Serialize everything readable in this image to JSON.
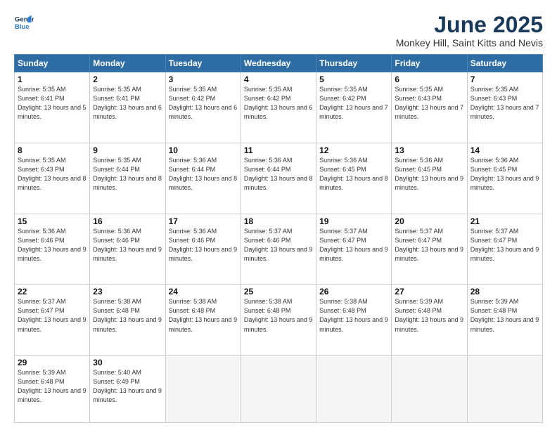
{
  "header": {
    "logo_line1": "General",
    "logo_line2": "Blue",
    "title": "June 2025",
    "location": "Monkey Hill, Saint Kitts and Nevis"
  },
  "weekdays": [
    "Sunday",
    "Monday",
    "Tuesday",
    "Wednesday",
    "Thursday",
    "Friday",
    "Saturday"
  ],
  "weeks": [
    [
      {
        "day": 1,
        "sunrise": "5:35 AM",
        "sunset": "6:41 PM",
        "daylight": "13 hours and 5 minutes."
      },
      {
        "day": 2,
        "sunrise": "5:35 AM",
        "sunset": "6:41 PM",
        "daylight": "13 hours and 6 minutes."
      },
      {
        "day": 3,
        "sunrise": "5:35 AM",
        "sunset": "6:42 PM",
        "daylight": "13 hours and 6 minutes."
      },
      {
        "day": 4,
        "sunrise": "5:35 AM",
        "sunset": "6:42 PM",
        "daylight": "13 hours and 6 minutes."
      },
      {
        "day": 5,
        "sunrise": "5:35 AM",
        "sunset": "6:42 PM",
        "daylight": "13 hours and 7 minutes."
      },
      {
        "day": 6,
        "sunrise": "5:35 AM",
        "sunset": "6:43 PM",
        "daylight": "13 hours and 7 minutes."
      },
      {
        "day": 7,
        "sunrise": "5:35 AM",
        "sunset": "6:43 PM",
        "daylight": "13 hours and 7 minutes."
      }
    ],
    [
      {
        "day": 8,
        "sunrise": "5:35 AM",
        "sunset": "6:43 PM",
        "daylight": "13 hours and 8 minutes."
      },
      {
        "day": 9,
        "sunrise": "5:35 AM",
        "sunset": "6:44 PM",
        "daylight": "13 hours and 8 minutes."
      },
      {
        "day": 10,
        "sunrise": "5:36 AM",
        "sunset": "6:44 PM",
        "daylight": "13 hours and 8 minutes."
      },
      {
        "day": 11,
        "sunrise": "5:36 AM",
        "sunset": "6:44 PM",
        "daylight": "13 hours and 8 minutes."
      },
      {
        "day": 12,
        "sunrise": "5:36 AM",
        "sunset": "6:45 PM",
        "daylight": "13 hours and 8 minutes."
      },
      {
        "day": 13,
        "sunrise": "5:36 AM",
        "sunset": "6:45 PM",
        "daylight": "13 hours and 9 minutes."
      },
      {
        "day": 14,
        "sunrise": "5:36 AM",
        "sunset": "6:45 PM",
        "daylight": "13 hours and 9 minutes."
      }
    ],
    [
      {
        "day": 15,
        "sunrise": "5:36 AM",
        "sunset": "6:46 PM",
        "daylight": "13 hours and 9 minutes."
      },
      {
        "day": 16,
        "sunrise": "5:36 AM",
        "sunset": "6:46 PM",
        "daylight": "13 hours and 9 minutes."
      },
      {
        "day": 17,
        "sunrise": "5:36 AM",
        "sunset": "6:46 PM",
        "daylight": "13 hours and 9 minutes."
      },
      {
        "day": 18,
        "sunrise": "5:37 AM",
        "sunset": "6:46 PM",
        "daylight": "13 hours and 9 minutes."
      },
      {
        "day": 19,
        "sunrise": "5:37 AM",
        "sunset": "6:47 PM",
        "daylight": "13 hours and 9 minutes."
      },
      {
        "day": 20,
        "sunrise": "5:37 AM",
        "sunset": "6:47 PM",
        "daylight": "13 hours and 9 minutes."
      },
      {
        "day": 21,
        "sunrise": "5:37 AM",
        "sunset": "6:47 PM",
        "daylight": "13 hours and 9 minutes."
      }
    ],
    [
      {
        "day": 22,
        "sunrise": "5:37 AM",
        "sunset": "6:47 PM",
        "daylight": "13 hours and 9 minutes."
      },
      {
        "day": 23,
        "sunrise": "5:38 AM",
        "sunset": "6:48 PM",
        "daylight": "13 hours and 9 minutes."
      },
      {
        "day": 24,
        "sunrise": "5:38 AM",
        "sunset": "6:48 PM",
        "daylight": "13 hours and 9 minutes."
      },
      {
        "day": 25,
        "sunrise": "5:38 AM",
        "sunset": "6:48 PM",
        "daylight": "13 hours and 9 minutes."
      },
      {
        "day": 26,
        "sunrise": "5:38 AM",
        "sunset": "6:48 PM",
        "daylight": "13 hours and 9 minutes."
      },
      {
        "day": 27,
        "sunrise": "5:39 AM",
        "sunset": "6:48 PM",
        "daylight": "13 hours and 9 minutes."
      },
      {
        "day": 28,
        "sunrise": "5:39 AM",
        "sunset": "6:48 PM",
        "daylight": "13 hours and 9 minutes."
      }
    ],
    [
      {
        "day": 29,
        "sunrise": "5:39 AM",
        "sunset": "6:48 PM",
        "daylight": "13 hours and 9 minutes."
      },
      {
        "day": 30,
        "sunrise": "5:40 AM",
        "sunset": "6:49 PM",
        "daylight": "13 hours and 9 minutes."
      },
      null,
      null,
      null,
      null,
      null
    ]
  ]
}
